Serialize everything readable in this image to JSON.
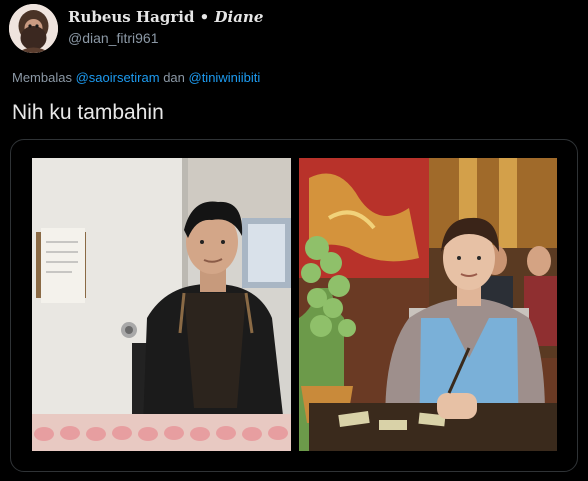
{
  "author": {
    "display_name": "Rubeus Hagrid",
    "separator": " • ",
    "display_name_suffix": "Diane",
    "handle": "@dian_fitri961"
  },
  "reply": {
    "prefix": "Membalas ",
    "mention_1": "@saoirsetiram",
    "joiner": " dan ",
    "mention_2": "@tiniwiniibiti"
  },
  "tweet": {
    "text": "Nih ku tambahin"
  },
  "icons": {
    "avatar": "hagrid-avatar",
    "media_left": "man-in-apron-photo",
    "media_right": "man-in-sweater-vest-photo"
  },
  "colors": {
    "background": "#000000",
    "text_primary": "#e8e8e8",
    "text_secondary": "#8b98a5",
    "link": "#1d9bf0",
    "card_border": "#2f3336"
  }
}
